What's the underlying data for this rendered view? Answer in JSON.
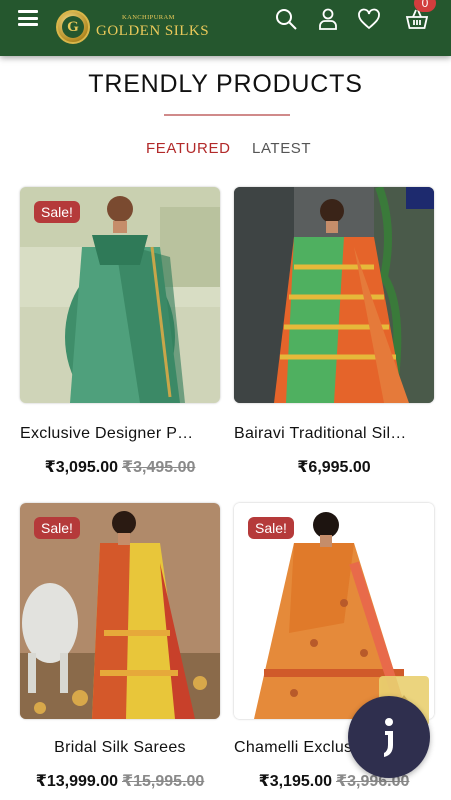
{
  "header": {
    "brand_small": "KANCHIPURAM",
    "brand_main": "GOLDEN SILKS",
    "logo_letter": "G",
    "cart_count": "0",
    "colors": {
      "bar": "#25572e",
      "badge": "#d23d3d",
      "gold": "#e9c95a"
    },
    "icons": [
      "menu-icon",
      "search-icon",
      "user-icon",
      "heart-icon",
      "basket-icon"
    ]
  },
  "section": {
    "title": "TRENDLY PRODUCTS",
    "tabs": [
      {
        "label": "FEATURED",
        "active": true
      },
      {
        "label": "LATEST",
        "active": false
      }
    ]
  },
  "products": [
    {
      "name": "Exclusive Designer P…",
      "price": "₹3,095.00",
      "old_price": "₹3,495.00",
      "sale_label": "Sale!"
    },
    {
      "name": "Bairavi Traditional Sil…",
      "price": "₹6,995.00",
      "old_price": "",
      "sale_label": ""
    },
    {
      "name": "Bridal Silk Sarees",
      "price": "₹13,999.00",
      "old_price": "₹15,995.00",
      "sale_label": "Sale!"
    },
    {
      "name": "Chamelli Exclusive…",
      "price": "₹3,195.00",
      "old_price": "₹3,996.00",
      "sale_label": "Sale!"
    }
  ],
  "floating": {
    "scroll_top_icon": "arrow-up-icon",
    "chat_icon": "chat-icon"
  }
}
